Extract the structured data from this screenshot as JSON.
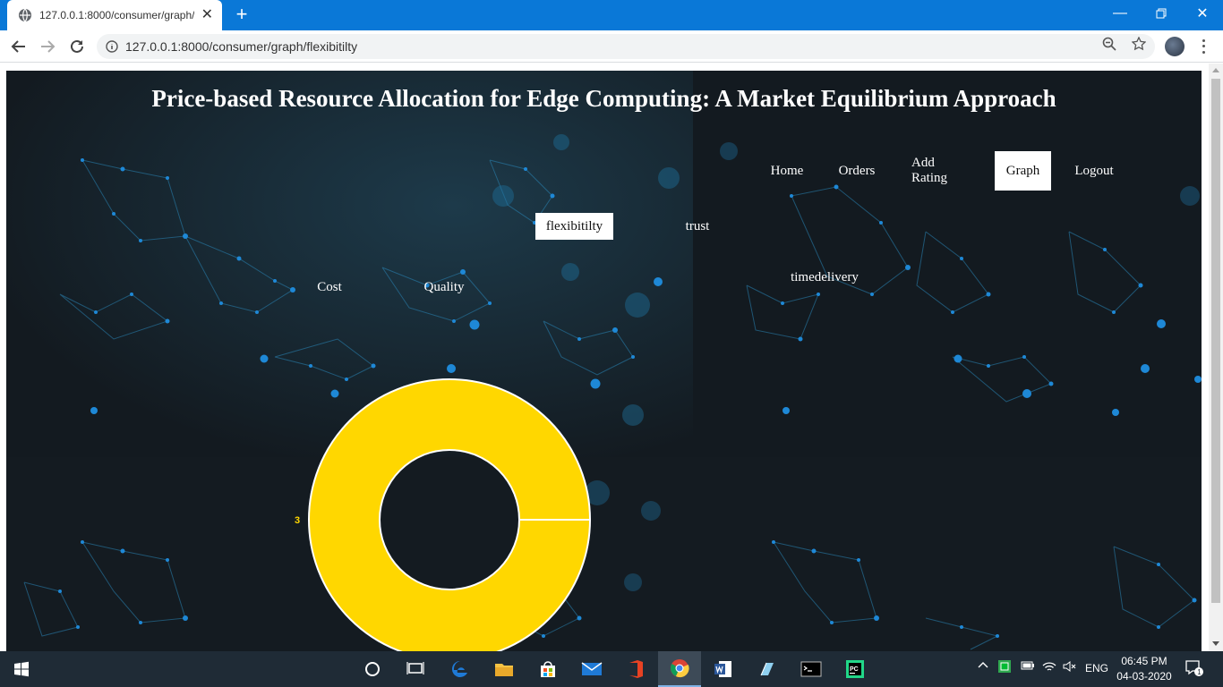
{
  "browser": {
    "tab_title": "127.0.0.1:8000/consumer/graph/f",
    "new_tab": "+",
    "url": "127.0.0.1:8000/consumer/graph/flexibitilty"
  },
  "page": {
    "title": "Price-based Resource Allocation for Edge Computing: A Market Equilibrium Approach",
    "nav": [
      {
        "label": "Home",
        "active": false
      },
      {
        "label": "Orders",
        "active": false
      },
      {
        "label": "Add Rating",
        "active": false
      },
      {
        "label": "Graph",
        "active": true
      },
      {
        "label": "Logout",
        "active": false
      }
    ],
    "criteria": [
      {
        "label": "flexibitilty",
        "active": true
      },
      {
        "label": "trust",
        "active": false
      },
      {
        "label": "Cost",
        "active": false
      },
      {
        "label": "Quality",
        "active": false
      },
      {
        "label": "timedelivery",
        "active": false
      }
    ]
  },
  "chart_data": {
    "type": "pie",
    "variant": "doughnut",
    "slices": [
      {
        "label": "3",
        "value": 100,
        "color": "#ffd700"
      }
    ]
  },
  "taskbar": {
    "apps": [
      "start-icon",
      "cortana-icon",
      "task-view-icon",
      "edge-icon",
      "file-explorer-icon",
      "store-icon",
      "mail-icon",
      "office-icon",
      "chrome-icon",
      "word-icon",
      "notepad-icon",
      "cmd-icon",
      "pycharm-icon"
    ],
    "language": "ENG",
    "time": "06:45 PM",
    "date": "04-03-2020",
    "notification_count": "1"
  },
  "colors": {
    "chrome_blue": "#0a78d7",
    "page_bg": "#151c22",
    "accent_node": "#1e88d6",
    "donut": "#ffd700",
    "taskbar": "#1f2b36"
  }
}
